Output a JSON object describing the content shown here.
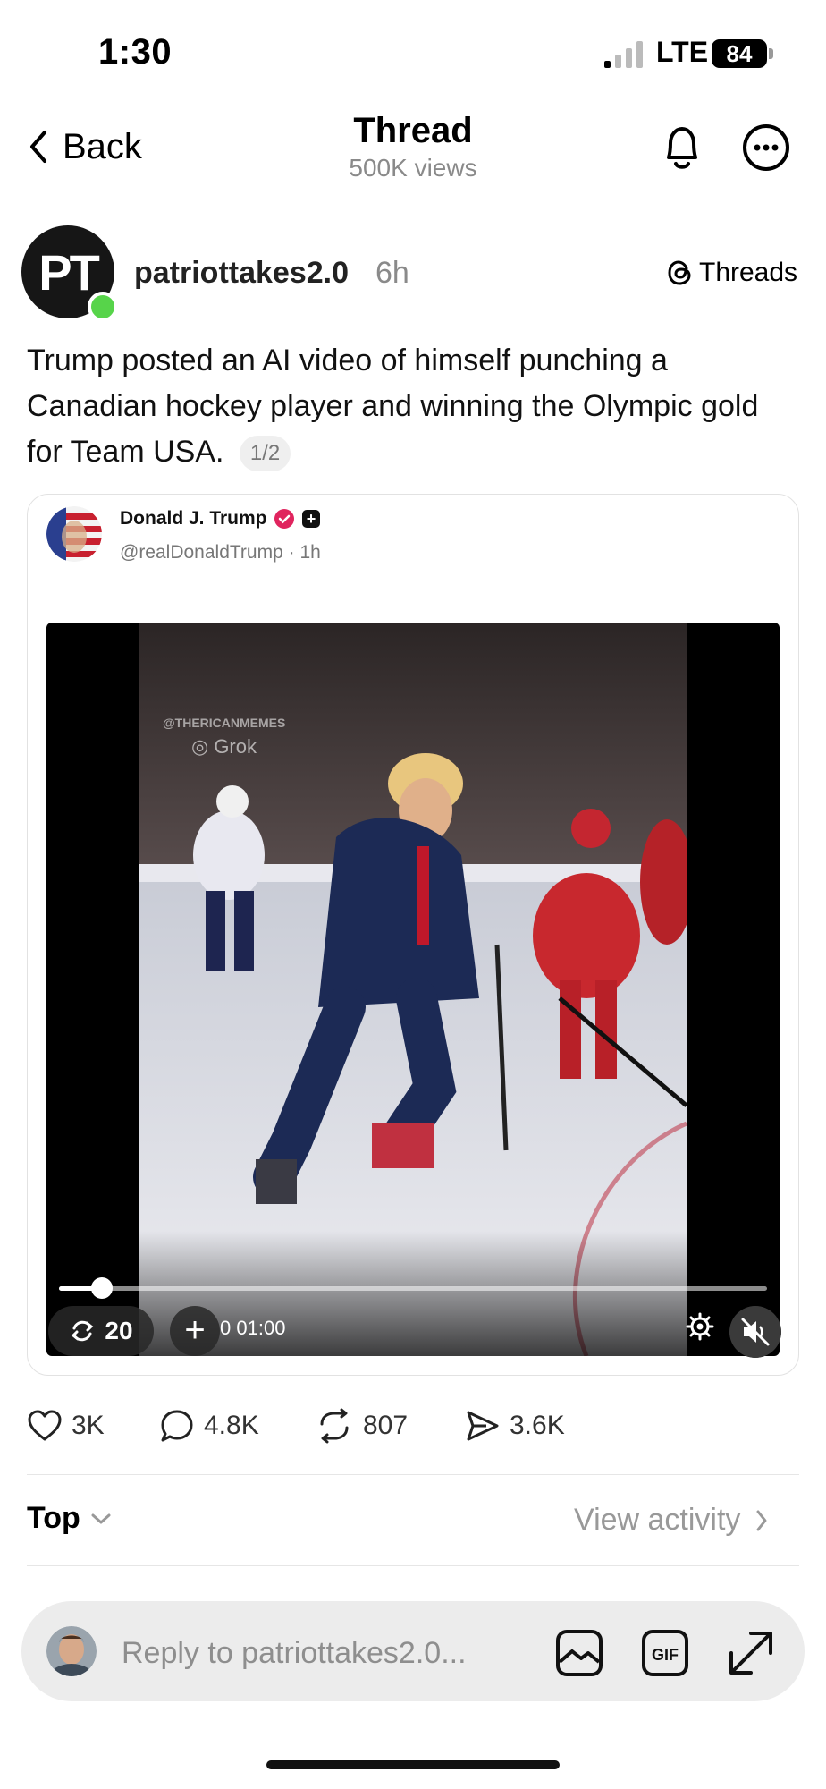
{
  "status_bar": {
    "time": "1:30",
    "network": "LTE",
    "battery": "84"
  },
  "header": {
    "back_label": "Back",
    "title": "Thread",
    "subtitle": "500K views"
  },
  "post": {
    "author": "patriottakes2.0",
    "avatar_initials": "PT",
    "time_ago": "6h",
    "source_label": "Threads",
    "text": "Trump posted an AI video of himself punching a Canadian hockey player and winning the Olympic gold for Team USA.",
    "page_indicator": "1/2",
    "embed": {
      "name": "Donald J. Trump",
      "handle": "@realDonaldTrump · 1h",
      "video": {
        "watermark_handle": "@THERICANMEMES",
        "watermark_brand": "Grok",
        "replay_count": "20",
        "time_left": "0",
        "time_right": "01:00",
        "progress": 0.06
      }
    },
    "actions": {
      "likes": "3K",
      "comments": "4.8K",
      "reposts": "807",
      "shares": "3.6K"
    }
  },
  "replies": {
    "sort_label": "Top",
    "view_activity_label": "View activity"
  },
  "reply_bar": {
    "placeholder": "Reply to patriottakes2.0..."
  },
  "colors": {
    "online": "#57d44a",
    "verified": "#e0245e",
    "accent": "#000000"
  }
}
